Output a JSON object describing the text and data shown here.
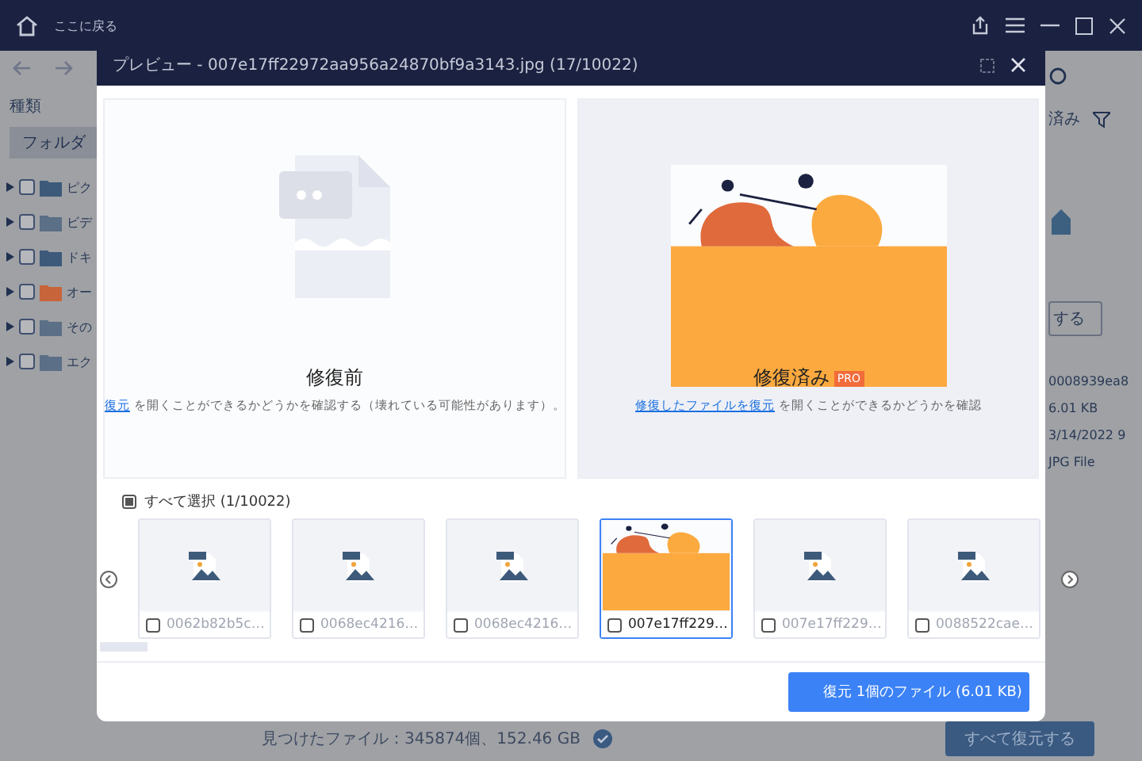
{
  "app": {
    "title": "ここに戻る",
    "filter": "種類",
    "folder_tab": "フォルダ",
    "tree": [
      {
        "label": "ピク",
        "checked": false,
        "color": "#3d5a7a"
      },
      {
        "label": "ビデ",
        "checked": false,
        "color": "#5b6f86"
      },
      {
        "label": "ドキ",
        "checked": false,
        "color": "#3d5a7a"
      },
      {
        "label": "オー",
        "checked": false,
        "color": "#c8643a"
      },
      {
        "label": "その",
        "checked": false,
        "color": "#5b6f86"
      },
      {
        "label": "エク",
        "checked": false,
        "color": "#5b6f86"
      }
    ],
    "right_tab": "済み",
    "right_button": "する",
    "details": [
      "0008939ea8",
      "6.01 KB",
      "3/14/2022 9",
      "JPG File"
    ],
    "status": "見つけたファイル：345874個、152.46 GB",
    "recover_all": "すべて復元する"
  },
  "dialog": {
    "title": "プレビュー - 007e17ff22972aa956a24870bf9a3143.jpg (17/10022)",
    "before": {
      "heading": "修復前",
      "link": "復元",
      "text": "を開くことができるかどうかを確認する（壊れている可能性があります）。"
    },
    "after": {
      "heading": "修復済み",
      "badge": "PRO",
      "link": "修復したファイルを復元",
      "text": "を開くことができるかどうかを確認"
    },
    "select_all": {
      "label": "すべて選択 (1/10022)",
      "checked": true
    },
    "thumbs": [
      {
        "name": "0062b82b5c…",
        "kind": "placeholder",
        "selected": false,
        "checked": false
      },
      {
        "name": "0068ec4216…",
        "kind": "placeholder",
        "selected": false,
        "checked": false
      },
      {
        "name": "0068ec4216…",
        "kind": "placeholder",
        "selected": false,
        "checked": false
      },
      {
        "name": "007e17ff229…",
        "kind": "photo",
        "selected": true,
        "checked": false
      },
      {
        "name": "007e17ff229…",
        "kind": "placeholder",
        "selected": false,
        "checked": false
      },
      {
        "name": "0088522cae…",
        "kind": "placeholder",
        "selected": false,
        "checked": false
      }
    ],
    "recover_button": "復元 1個のファイル (6.01 KB)"
  }
}
